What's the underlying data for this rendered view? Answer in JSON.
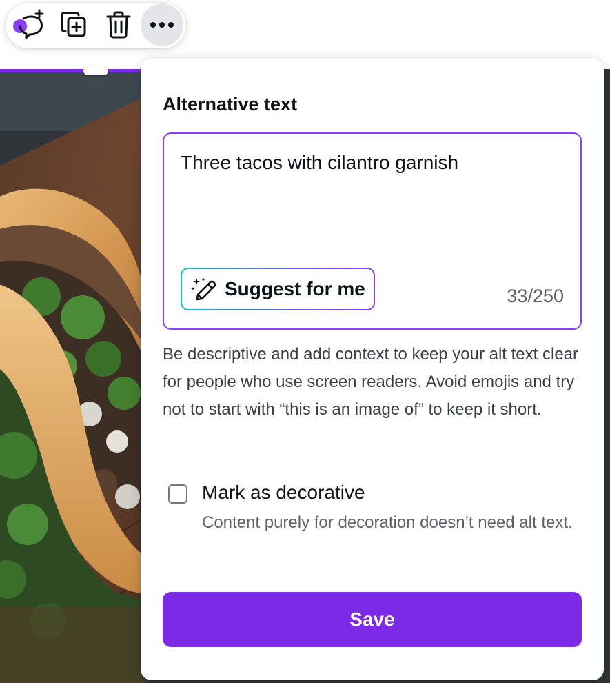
{
  "toolbar": {
    "buttons": [
      {
        "name": "comment",
        "icon": "comment-add-icon"
      },
      {
        "name": "duplicate",
        "icon": "duplicate-icon"
      },
      {
        "name": "delete",
        "icon": "trash-icon"
      },
      {
        "name": "more",
        "icon": "more-horizontal-icon"
      }
    ]
  },
  "canvas": {
    "selected_element": "image",
    "selection_color": "#7d2ae8"
  },
  "alt_text_panel": {
    "title": "Alternative text",
    "input": {
      "value": "Three tacos with cilantro garnish",
      "char_count": "33/250",
      "focused": true
    },
    "suggest_button": {
      "label": "Suggest for me",
      "icon": "magic-pencil-icon"
    },
    "helper_text": "Be descriptive and add context to keep your alt text clear for people who use screen readers. Avoid emojis and try not to start with “this is an image of” to keep it short.",
    "decorative": {
      "label": "Mark as decorative",
      "description": "Content purely for decoration doesn’t need alt text.",
      "checked": false
    },
    "save_label": "Save"
  },
  "colors": {
    "accent": "#7d2ae8",
    "focus_border": "#8b3dff",
    "text_primary": "#0e1318",
    "text_secondary": "#5e6368"
  }
}
